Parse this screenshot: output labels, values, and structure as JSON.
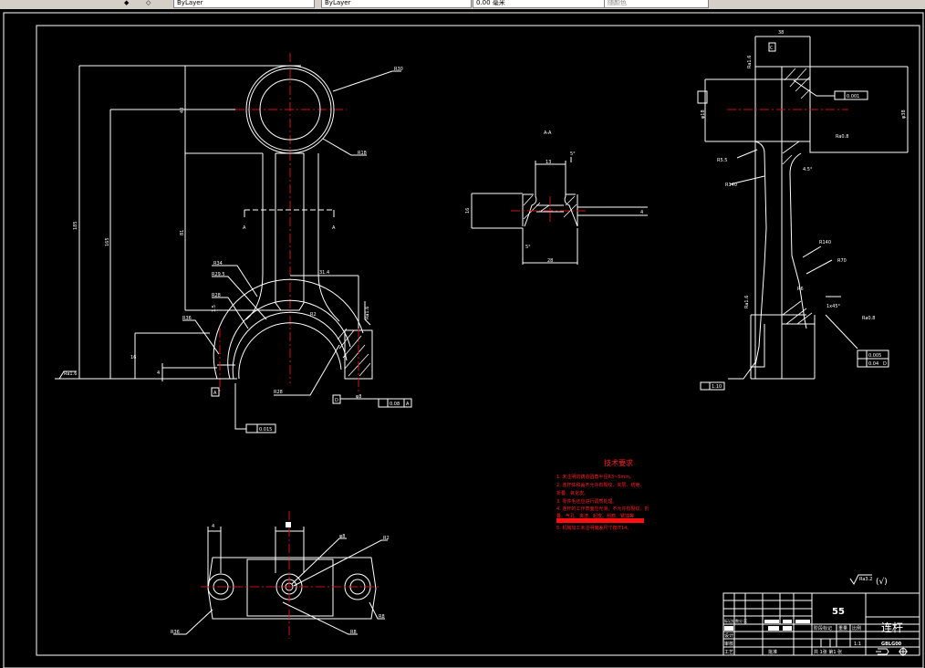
{
  "toolbar": {
    "layer_field": "ByLayer",
    "linetype_field": "ByLayer",
    "lineweight_field": "0.00 毫米",
    "plotstyle_field": "随颜色"
  },
  "drawing": {
    "background": "#000000",
    "line_color": "#ffffff",
    "centerline_color": "#d01010",
    "front_view": {
      "labels": {
        "r_top": "R30",
        "r_small": "R18",
        "len_total": "185",
        "len_center": "165",
        "len_shank": "81",
        "dim_40": "40",
        "section_a_left": "A",
        "section_a_right": "A",
        "r34": "R34",
        "r29_5": "R29.5",
        "r28": "R28",
        "r36": "R36",
        "dim_1_5": "1.5",
        "dim_31_4": "31.4",
        "r_hatch": "R2",
        "ra_left": "Ra1.6",
        "ra_right": "Ra1.6",
        "dim_16": "16",
        "dim_4": "4",
        "datum_a": "A",
        "flatness": "0.015",
        "r_bore": "R28",
        "datum_d": "D",
        "perp_value": "0.08",
        "perp_datum": "A",
        "dim_bolt": "φ8"
      }
    },
    "section_view": {
      "title": "A-A",
      "labels": {
        "draft_top": "5°",
        "width_top": "13",
        "height": "16",
        "web": "4",
        "draft_bottom": "5°",
        "width_bottom": "28"
      }
    },
    "side_view": {
      "labels": {
        "top_width": "38",
        "datum_c": "C",
        "ra_top": "Ra1.6",
        "parallel": "0.001",
        "dia_left": "φ18",
        "dia_right": "φ38",
        "ra_mid": "Ra0.8",
        "r5_5": "R5.5",
        "r140_a": "R140",
        "angle": "4.5°",
        "r140_b": "R140",
        "r70": "R70",
        "mark": "R6",
        "chamfer": "1x45°",
        "ra_bottom_left": "Ra1.6",
        "ra_bottom": "Ra0.8",
        "tol_1": "0.005",
        "tol_2": "0.04",
        "tol_2_datum": "D",
        "taper": "1:10"
      }
    },
    "bottom_view": {
      "labels": {
        "dim_4": "4",
        "dim_16": "16",
        "phi8": "φ8",
        "r2_top": "R2",
        "r36": "R36",
        "r8_right": "R8",
        "r8_bottom": "R8"
      }
    },
    "tech_requirements": {
      "title": "技术要求",
      "items": [
        "1. 未注明的铸造圆角半径R3~5mm。",
        "2. 连杆体和盖不允许有裂纹、夹层、结疤、",
        "   折叠、氧化皮。",
        "3. 零件毛坯应进行调质处理。",
        "4. 连杆的工作表面应光滑，不允许有裂纹、折",
        "   叠、气孔、夹渣、起皮、刮痕、锈蚀等",
        "5. 机械加工未注明偏差尺寸按IT14。"
      ],
      "text_color": "#ff2020"
    },
    "roughness_note": "Ra3.2",
    "roughness_other": "(√)"
  },
  "title_block": {
    "material": "55",
    "part_name": "连杆",
    "drawing_no": "GBLG00",
    "stage_label": "阶段标记",
    "weight_label": "重量",
    "scale_label": "比例",
    "scale_value": "1:1",
    "sheets": "共 1张 第1 张",
    "mark_label": "标记处数分 区",
    "design_label": "设计",
    "review_label": "审核",
    "process_label": "工艺",
    "approve_label": "批准"
  }
}
